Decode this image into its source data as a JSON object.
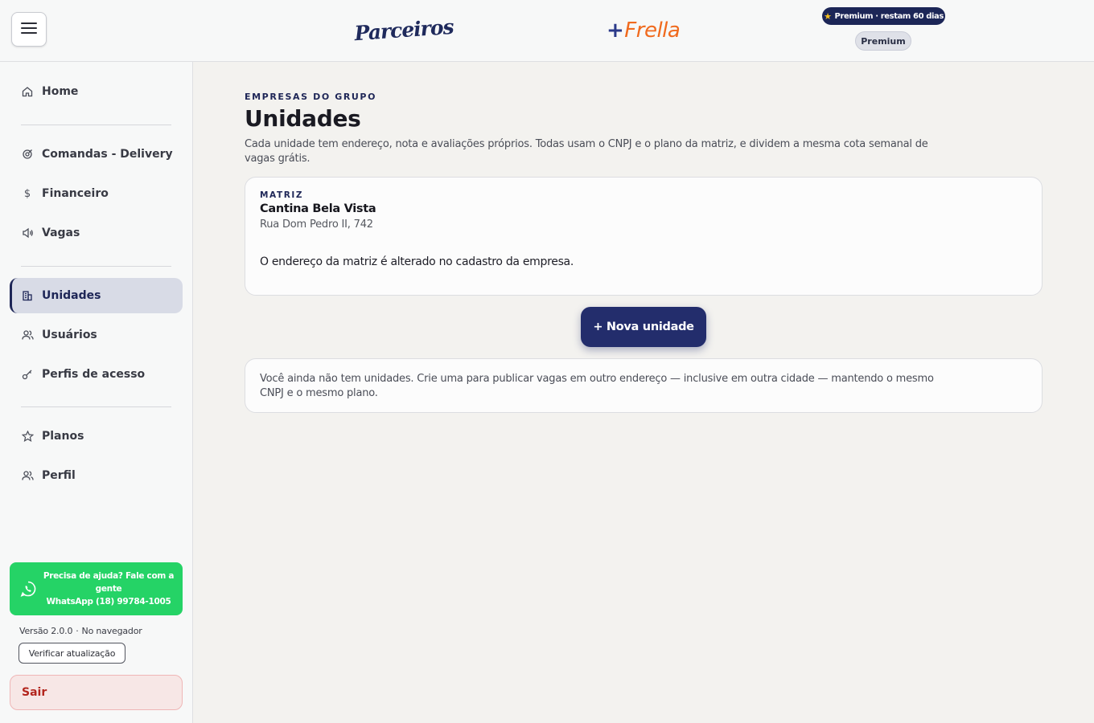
{
  "header": {
    "menu_icon": "hamburger-menu-icon",
    "logo_parceiros": "Parceiros",
    "logo_frella_plus": "+",
    "logo_frella_text": "Frella",
    "premium_badge_text": "Premium · restam 60 dias",
    "premium_badge_icon": "star-icon",
    "premium_pill": "Premium",
    "colors": {
      "brand_navy": "#1e2657",
      "frella_orange": "#f06a1e",
      "star": "#f5c01f"
    }
  },
  "sidebar": {
    "items": [
      {
        "label": "Home",
        "icon": "home-icon"
      },
      {
        "label": "Comandas - Delivery",
        "icon": "target-icon"
      },
      {
        "label": "Financeiro",
        "icon": "dollar-icon"
      },
      {
        "label": "Vagas",
        "icon": "megaphone-icon"
      },
      {
        "label": "Unidades",
        "icon": "building-icon",
        "active": true
      },
      {
        "label": "Usuários",
        "icon": "users-icon"
      },
      {
        "label": "Perfis de acesso",
        "icon": "key-icon"
      },
      {
        "label": "Planos",
        "icon": "star-icon"
      },
      {
        "label": "Perfil",
        "icon": "user-icon"
      }
    ],
    "help": {
      "line1": "Precisa de ajuda? Fale com a gente",
      "line2": "WhatsApp (18) 99784-1005",
      "icon": "whatsapp-icon",
      "color": "#25d366"
    },
    "version_label": "Versão 2.0.0",
    "version_mode": "No navegador",
    "verify_label": "Verificar atualização",
    "logout_label": "Sair"
  },
  "main": {
    "eyebrow": "EMPRESAS DO GRUPO",
    "title": "Unidades",
    "description": "Cada unidade tem endereço, nota e avaliações próprios. Todas usam o CNPJ e o plano da matriz, e dividem a mesma cota semanal de vagas grátis.",
    "matriz": {
      "tag": "MATRIZ",
      "name": "Cantina Bela Vista",
      "address": "Rua Dom Pedro II, 742",
      "note": "O endereço da matriz é alterado no cadastro da empresa."
    },
    "new_unit_label": "+ Nova unidade",
    "empty_message": "Você ainda não tem unidades. Crie uma para publicar vagas em outro endereço — inclusive em outra cidade — mantendo o mesmo CNPJ e o mesmo plano."
  }
}
